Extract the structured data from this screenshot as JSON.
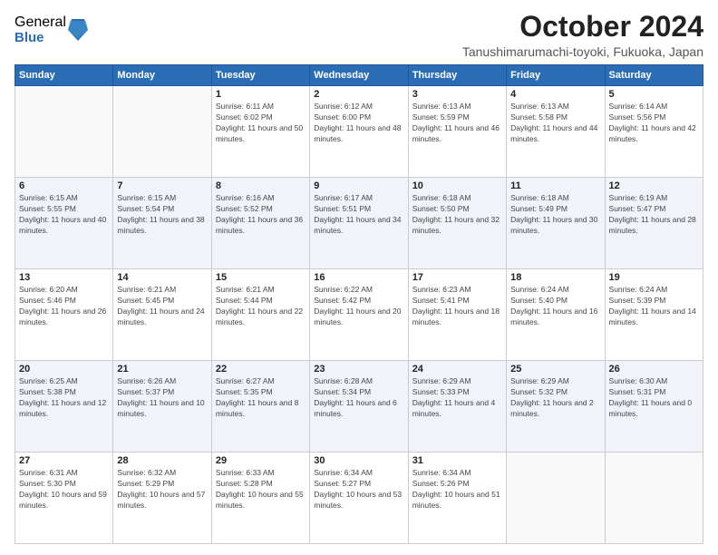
{
  "logo": {
    "general": "General",
    "blue": "Blue"
  },
  "title": {
    "month_year": "October 2024",
    "location": "Tanushimarumachi-toyoki, Fukuoka, Japan"
  },
  "days_of_week": [
    "Sunday",
    "Monday",
    "Tuesday",
    "Wednesday",
    "Thursday",
    "Friday",
    "Saturday"
  ],
  "weeks": [
    [
      {
        "day": "",
        "sunrise": "",
        "sunset": "",
        "daylight": ""
      },
      {
        "day": "",
        "sunrise": "",
        "sunset": "",
        "daylight": ""
      },
      {
        "day": "1",
        "sunrise": "Sunrise: 6:11 AM",
        "sunset": "Sunset: 6:02 PM",
        "daylight": "Daylight: 11 hours and 50 minutes."
      },
      {
        "day": "2",
        "sunrise": "Sunrise: 6:12 AM",
        "sunset": "Sunset: 6:00 PM",
        "daylight": "Daylight: 11 hours and 48 minutes."
      },
      {
        "day": "3",
        "sunrise": "Sunrise: 6:13 AM",
        "sunset": "Sunset: 5:59 PM",
        "daylight": "Daylight: 11 hours and 46 minutes."
      },
      {
        "day": "4",
        "sunrise": "Sunrise: 6:13 AM",
        "sunset": "Sunset: 5:58 PM",
        "daylight": "Daylight: 11 hours and 44 minutes."
      },
      {
        "day": "5",
        "sunrise": "Sunrise: 6:14 AM",
        "sunset": "Sunset: 5:56 PM",
        "daylight": "Daylight: 11 hours and 42 minutes."
      }
    ],
    [
      {
        "day": "6",
        "sunrise": "Sunrise: 6:15 AM",
        "sunset": "Sunset: 5:55 PM",
        "daylight": "Daylight: 11 hours and 40 minutes."
      },
      {
        "day": "7",
        "sunrise": "Sunrise: 6:15 AM",
        "sunset": "Sunset: 5:54 PM",
        "daylight": "Daylight: 11 hours and 38 minutes."
      },
      {
        "day": "8",
        "sunrise": "Sunrise: 6:16 AM",
        "sunset": "Sunset: 5:52 PM",
        "daylight": "Daylight: 11 hours and 36 minutes."
      },
      {
        "day": "9",
        "sunrise": "Sunrise: 6:17 AM",
        "sunset": "Sunset: 5:51 PM",
        "daylight": "Daylight: 11 hours and 34 minutes."
      },
      {
        "day": "10",
        "sunrise": "Sunrise: 6:18 AM",
        "sunset": "Sunset: 5:50 PM",
        "daylight": "Daylight: 11 hours and 32 minutes."
      },
      {
        "day": "11",
        "sunrise": "Sunrise: 6:18 AM",
        "sunset": "Sunset: 5:49 PM",
        "daylight": "Daylight: 11 hours and 30 minutes."
      },
      {
        "day": "12",
        "sunrise": "Sunrise: 6:19 AM",
        "sunset": "Sunset: 5:47 PM",
        "daylight": "Daylight: 11 hours and 28 minutes."
      }
    ],
    [
      {
        "day": "13",
        "sunrise": "Sunrise: 6:20 AM",
        "sunset": "Sunset: 5:46 PM",
        "daylight": "Daylight: 11 hours and 26 minutes."
      },
      {
        "day": "14",
        "sunrise": "Sunrise: 6:21 AM",
        "sunset": "Sunset: 5:45 PM",
        "daylight": "Daylight: 11 hours and 24 minutes."
      },
      {
        "day": "15",
        "sunrise": "Sunrise: 6:21 AM",
        "sunset": "Sunset: 5:44 PM",
        "daylight": "Daylight: 11 hours and 22 minutes."
      },
      {
        "day": "16",
        "sunrise": "Sunrise: 6:22 AM",
        "sunset": "Sunset: 5:42 PM",
        "daylight": "Daylight: 11 hours and 20 minutes."
      },
      {
        "day": "17",
        "sunrise": "Sunrise: 6:23 AM",
        "sunset": "Sunset: 5:41 PM",
        "daylight": "Daylight: 11 hours and 18 minutes."
      },
      {
        "day": "18",
        "sunrise": "Sunrise: 6:24 AM",
        "sunset": "Sunset: 5:40 PM",
        "daylight": "Daylight: 11 hours and 16 minutes."
      },
      {
        "day": "19",
        "sunrise": "Sunrise: 6:24 AM",
        "sunset": "Sunset: 5:39 PM",
        "daylight": "Daylight: 11 hours and 14 minutes."
      }
    ],
    [
      {
        "day": "20",
        "sunrise": "Sunrise: 6:25 AM",
        "sunset": "Sunset: 5:38 PM",
        "daylight": "Daylight: 11 hours and 12 minutes."
      },
      {
        "day": "21",
        "sunrise": "Sunrise: 6:26 AM",
        "sunset": "Sunset: 5:37 PM",
        "daylight": "Daylight: 11 hours and 10 minutes."
      },
      {
        "day": "22",
        "sunrise": "Sunrise: 6:27 AM",
        "sunset": "Sunset: 5:35 PM",
        "daylight": "Daylight: 11 hours and 8 minutes."
      },
      {
        "day": "23",
        "sunrise": "Sunrise: 6:28 AM",
        "sunset": "Sunset: 5:34 PM",
        "daylight": "Daylight: 11 hours and 6 minutes."
      },
      {
        "day": "24",
        "sunrise": "Sunrise: 6:29 AM",
        "sunset": "Sunset: 5:33 PM",
        "daylight": "Daylight: 11 hours and 4 minutes."
      },
      {
        "day": "25",
        "sunrise": "Sunrise: 6:29 AM",
        "sunset": "Sunset: 5:32 PM",
        "daylight": "Daylight: 11 hours and 2 minutes."
      },
      {
        "day": "26",
        "sunrise": "Sunrise: 6:30 AM",
        "sunset": "Sunset: 5:31 PM",
        "daylight": "Daylight: 11 hours and 0 minutes."
      }
    ],
    [
      {
        "day": "27",
        "sunrise": "Sunrise: 6:31 AM",
        "sunset": "Sunset: 5:30 PM",
        "daylight": "Daylight: 10 hours and 59 minutes."
      },
      {
        "day": "28",
        "sunrise": "Sunrise: 6:32 AM",
        "sunset": "Sunset: 5:29 PM",
        "daylight": "Daylight: 10 hours and 57 minutes."
      },
      {
        "day": "29",
        "sunrise": "Sunrise: 6:33 AM",
        "sunset": "Sunset: 5:28 PM",
        "daylight": "Daylight: 10 hours and 55 minutes."
      },
      {
        "day": "30",
        "sunrise": "Sunrise: 6:34 AM",
        "sunset": "Sunset: 5:27 PM",
        "daylight": "Daylight: 10 hours and 53 minutes."
      },
      {
        "day": "31",
        "sunrise": "Sunrise: 6:34 AM",
        "sunset": "Sunset: 5:26 PM",
        "daylight": "Daylight: 10 hours and 51 minutes."
      },
      {
        "day": "",
        "sunrise": "",
        "sunset": "",
        "daylight": ""
      },
      {
        "day": "",
        "sunrise": "",
        "sunset": "",
        "daylight": ""
      }
    ]
  ]
}
